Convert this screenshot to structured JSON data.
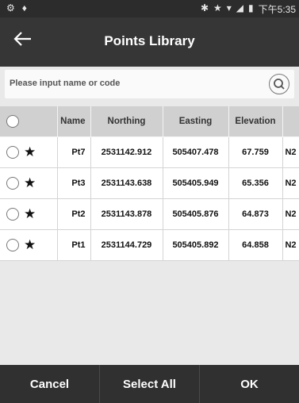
{
  "statusbar": {
    "time": "下午5:35",
    "left_icons": [
      "settings-icon",
      "location-icon"
    ],
    "right_icons": [
      "bluetooth-icon",
      "star-icon",
      "wifi-icon",
      "signal-icon",
      "battery-icon"
    ]
  },
  "header": {
    "title": "Points Library",
    "back_icon": "back-arrow-icon"
  },
  "search": {
    "placeholder": "Please input name or code",
    "button_icon": "search-icon"
  },
  "table": {
    "columns": [
      "Name",
      "Northing",
      "Easting",
      "Elevation"
    ],
    "rows": [
      {
        "name": "Pt7",
        "northing": "2531142.912",
        "easting": "505407.478",
        "elevation": "67.759",
        "extra": "N2"
      },
      {
        "name": "Pt3",
        "northing": "2531143.638",
        "easting": "505405.949",
        "elevation": "65.356",
        "extra": "N2"
      },
      {
        "name": "Pt2",
        "northing": "2531143.878",
        "easting": "505405.876",
        "elevation": "64.873",
        "extra": "N2"
      },
      {
        "name": "Pt1",
        "northing": "2531144.729",
        "easting": "505405.892",
        "elevation": "64.858",
        "extra": "N2"
      }
    ]
  },
  "footer": {
    "cancel": "Cancel",
    "select_all": "Select All",
    "ok": "OK"
  }
}
